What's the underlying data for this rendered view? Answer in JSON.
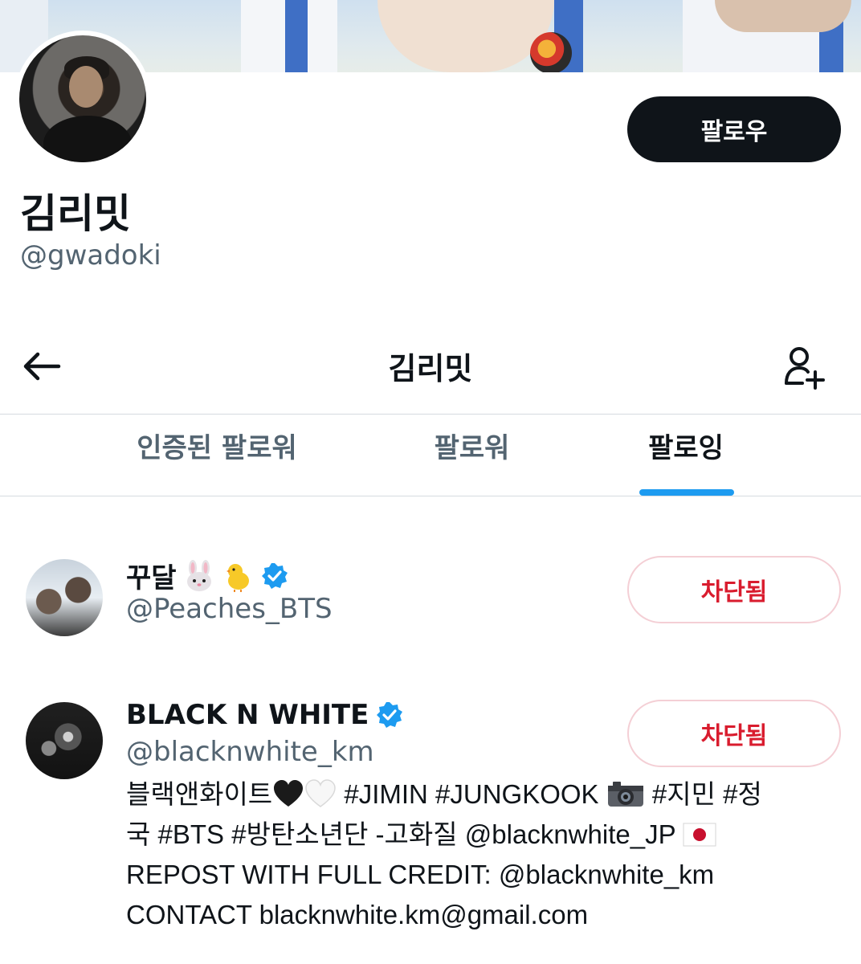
{
  "profile": {
    "display_name": "김리밋",
    "handle": "@gwadoki",
    "follow_label": "팔로우"
  },
  "nav": {
    "title": "김리밋"
  },
  "tabs": [
    {
      "label": "인증된 팔로워",
      "active": false
    },
    {
      "label": "팔로워",
      "active": false
    },
    {
      "label": "팔로잉",
      "active": true
    }
  ],
  "colors": {
    "accent": "#1d9bf0",
    "blocked_text": "#d91c2e",
    "blocked_border": "#f4cfd5",
    "secondary_text": "#536471"
  },
  "accounts": [
    {
      "name": "꾸달",
      "name_emojis": [
        "rabbit-face",
        "baby-chick"
      ],
      "verified": true,
      "handle": "@Peaches_BTS",
      "button_label": "차단됨"
    },
    {
      "name": "BLACK N WHITE",
      "verified": true,
      "handle": "@blacknwhite_km",
      "button_label": "차단됨",
      "bio": {
        "line1_a": "블랙앤화이트",
        "line1_b": " #JIMIN #JUNGKOOK ",
        "line1_c": " #지민 #정",
        "line2_a": "국 #BTS #방탄소년단 -고화질 @blacknwhite_JP ",
        "line3": "REPOST WITH FULL CREDIT: @blacknwhite_km",
        "line4": "CONTACT blacknwhite.km@gmail.com",
        "emojis": [
          "black-heart",
          "white-heart",
          "camera",
          "japan-flag"
        ]
      }
    }
  ]
}
